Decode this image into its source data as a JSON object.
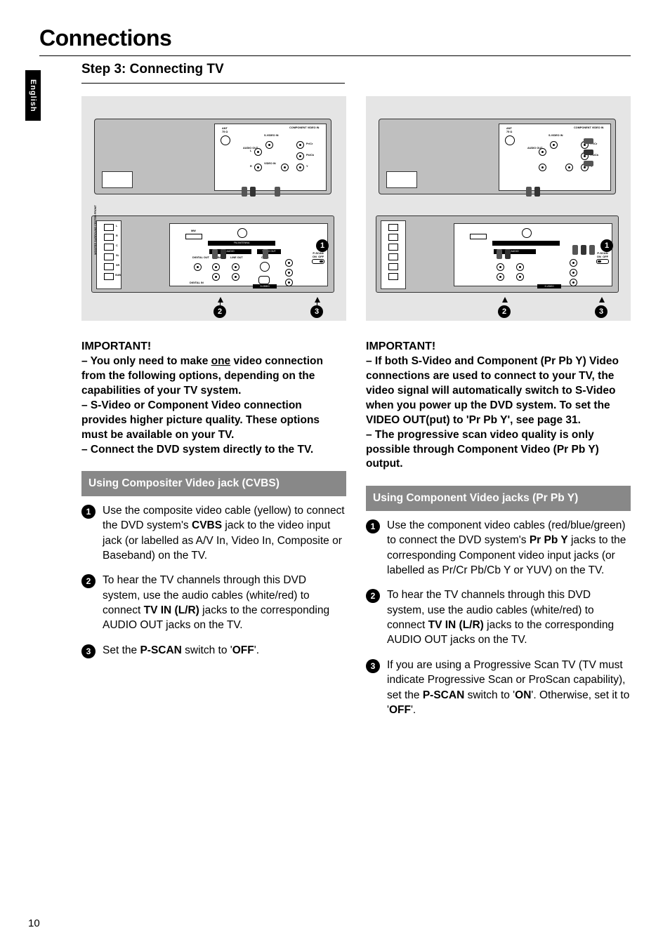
{
  "page": {
    "title": "Connections",
    "language_tab": "English",
    "page_number": "10",
    "step_header": "Step 3:   Connecting TV"
  },
  "diagram_labels": {
    "ant": "ANT",
    "ant_sub": "75 Ω",
    "component_video_in": "COMPONENT\nVIDEO IN",
    "svideo_in": "S-VIDEO\nIN",
    "audio_out": "AUDIO\nOUT",
    "video_in": "VIDEO IN",
    "L": "L",
    "R": "R",
    "prcr": "Pr/Cr",
    "pbcb": "Pb/Cb",
    "Y": "Y",
    "mw": "MW",
    "fm_antenna": "FM ANTENNA",
    "audio": "AUDIO",
    "digital_out": "DIGITAL\nOUT",
    "tv_in": "TV\nIN",
    "line_out": "LINE\nOUT",
    "video_out": "VIDEO\nOUT",
    "cvbs": "CVBS",
    "svideo": "S-VIDEO",
    "digital_in": "DIGITAL\nIN",
    "pscan": "P-SCAN",
    "on": "ON",
    "off": "OFF",
    "speaker_header": "WOOFER SURROUND CENTER  FRONT",
    "sp_l": "L",
    "sp_r": "R",
    "sp_c": "C",
    "sp_sl": "SL",
    "sp_sr": "SR",
    "sp_sub": "SUB",
    "badge1": "1",
    "badge2": "2",
    "badge3": "3"
  },
  "left": {
    "important_heading": "IMPORTANT!",
    "important_body_parts": {
      "p1a": "–  You only need to make ",
      "p1_one": "one",
      "p1b": " video connection from the following options, depending on the capabilities of your TV system.",
      "p2": "–  S-Video or Component Video connection provides higher picture quality.  These options must be available on your TV.",
      "p3": "–  Connect the DVD system directly to the TV."
    },
    "section_title": "Using Compositer Video jack (CVBS)",
    "steps": [
      {
        "num": "1",
        "pre": "Use the composite video cable (yellow) to connect the DVD system's ",
        "b1": "CVBS",
        "post": " jack to the video input jack (or labelled as A/V In,  Video In, Composite or Baseband) on the TV."
      },
      {
        "num": "2",
        "pre": "To hear the TV channels through this DVD system, use the audio cables (white/red) to connect ",
        "b1": "TV IN (L/R)",
        "post": " jacks to the corresponding AUDIO OUT jacks on the TV."
      },
      {
        "num": "3",
        "pre": "Set the ",
        "b1": "P-SCAN",
        "mid": " switch to '",
        "b2": "OFF",
        "post": "'."
      }
    ]
  },
  "right": {
    "important_heading": "IMPORTANT!",
    "important_body_parts": {
      "p1": "–  If both S-Video and Component (Pr Pb Y) Video connections are used to connect to your TV, the video signal will automatically switch to S-Video when you power up the DVD system.  To set the  VIDEO OUT(put) to 'Pr Pb Y', see page 31.",
      "p2": "–  The progressive scan video quality is only possible through Component Video (Pr Pb Y) output."
    },
    "section_title": "Using Component Video jacks (Pr Pb Y)",
    "steps": [
      {
        "num": "1",
        "pre": "Use the component video cables (red/blue/green) to connect the DVD system's ",
        "b1": "Pr Pb Y",
        "post": " jacks to the corresponding Component video input jacks (or labelled as Pr/Cr Pb/Cb Y or YUV) on the TV."
      },
      {
        "num": "2",
        "pre": "To hear the TV channels through this DVD system, use the audio cables (white/red) to connect ",
        "b1": "TV IN (L/R)",
        "post": " jacks to the corresponding AUDIO OUT jacks on the TV."
      },
      {
        "num": "3",
        "pre": "If you are using a Progressive Scan TV (TV must indicate Progressive Scan or ProScan capability), set the ",
        "b1": "P-SCAN",
        "mid": " switch to '",
        "b2": "ON",
        "post1": "'.  Otherwise, set it to '",
        "b3": "OFF",
        "post2": "'."
      }
    ]
  }
}
